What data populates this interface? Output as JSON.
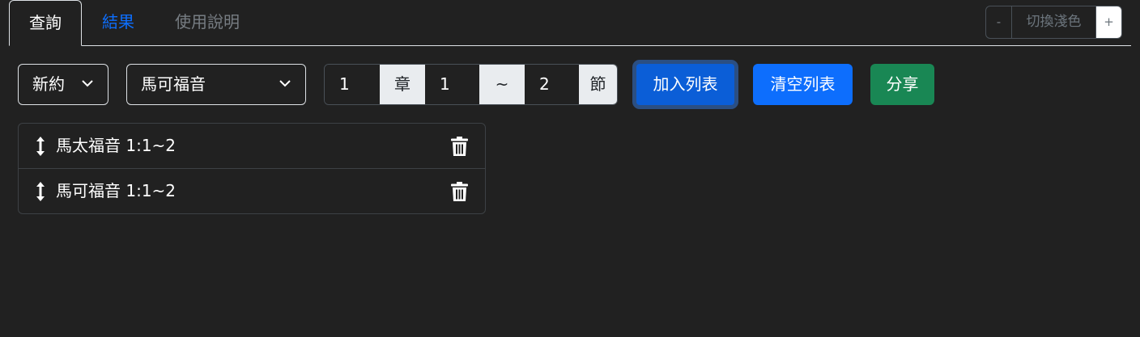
{
  "tabs": [
    {
      "label": "查詢"
    },
    {
      "label": "結果"
    },
    {
      "label": "使用說明"
    }
  ],
  "theme": {
    "minus": "-",
    "label": "切換淺色",
    "plus": "+"
  },
  "form": {
    "testament": "新約",
    "book": "馬可福音",
    "chapter_start": "1",
    "chapter_label": "章",
    "verse_start": "1",
    "range_sep": "~",
    "verse_end": "2",
    "verse_label": "節"
  },
  "buttons": {
    "add": "加入列表",
    "clear": "清空列表",
    "share": "分享"
  },
  "list": [
    {
      "text": "馬太福音 1:1~2"
    },
    {
      "text": "馬可福音 1:1~2"
    }
  ],
  "colors": {
    "primary": "#0d6efd",
    "success": "#198754",
    "background": "#212121"
  }
}
